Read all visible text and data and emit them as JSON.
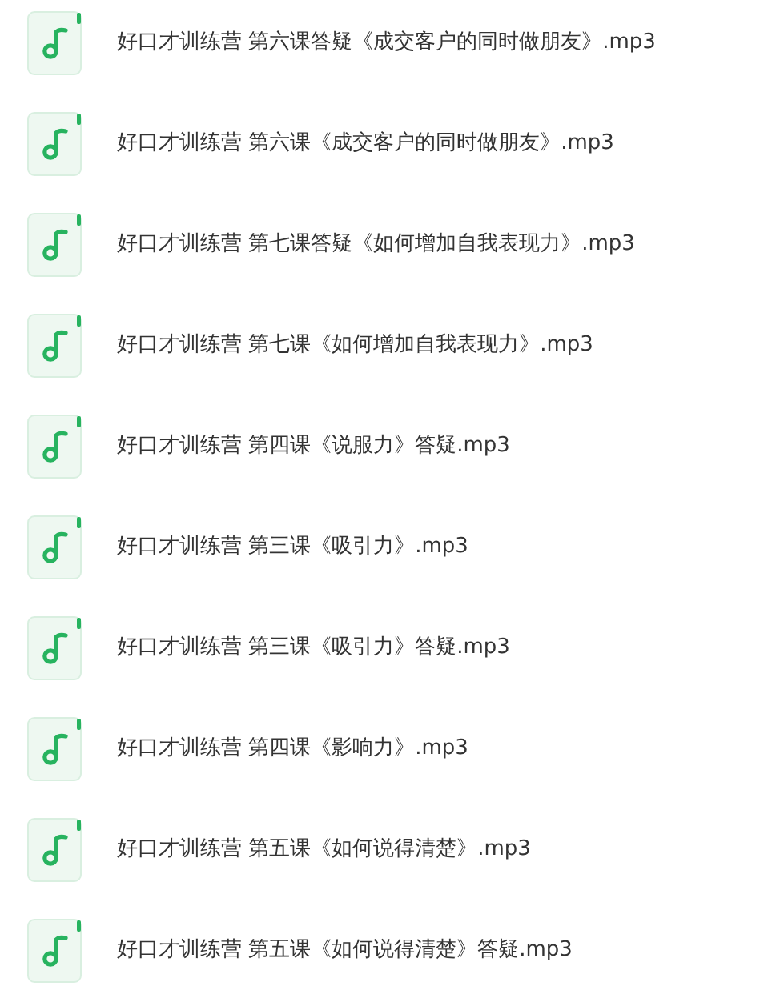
{
  "files": [
    {
      "name": "好口才训练营 第六课答疑《成交客户的同时做朋友》.mp3",
      "kind": "audio"
    },
    {
      "name": "好口才训练营 第六课《成交客户的同时做朋友》.mp3",
      "kind": "audio"
    },
    {
      "name": "好口才训练营 第七课答疑《如何增加自我表现力》.mp3",
      "kind": "audio"
    },
    {
      "name": "好口才训练营 第七课《如何增加自我表现力》.mp3",
      "kind": "audio"
    },
    {
      "name": "好口才训练营 第四课《说服力》答疑.mp3",
      "kind": "audio"
    },
    {
      "name": "好口才训练营 第三课《吸引力》.mp3",
      "kind": "audio"
    },
    {
      "name": "好口才训练营 第三课《吸引力》答疑.mp3",
      "kind": "audio"
    },
    {
      "name": "好口才训练营 第四课《影响力》.mp3",
      "kind": "audio"
    },
    {
      "name": "好口才训练营 第五课《如何说得清楚》.mp3",
      "kind": "audio"
    },
    {
      "name": "好口才训练营 第五课《如何说得清楚》答疑.mp3",
      "kind": "audio"
    }
  ]
}
